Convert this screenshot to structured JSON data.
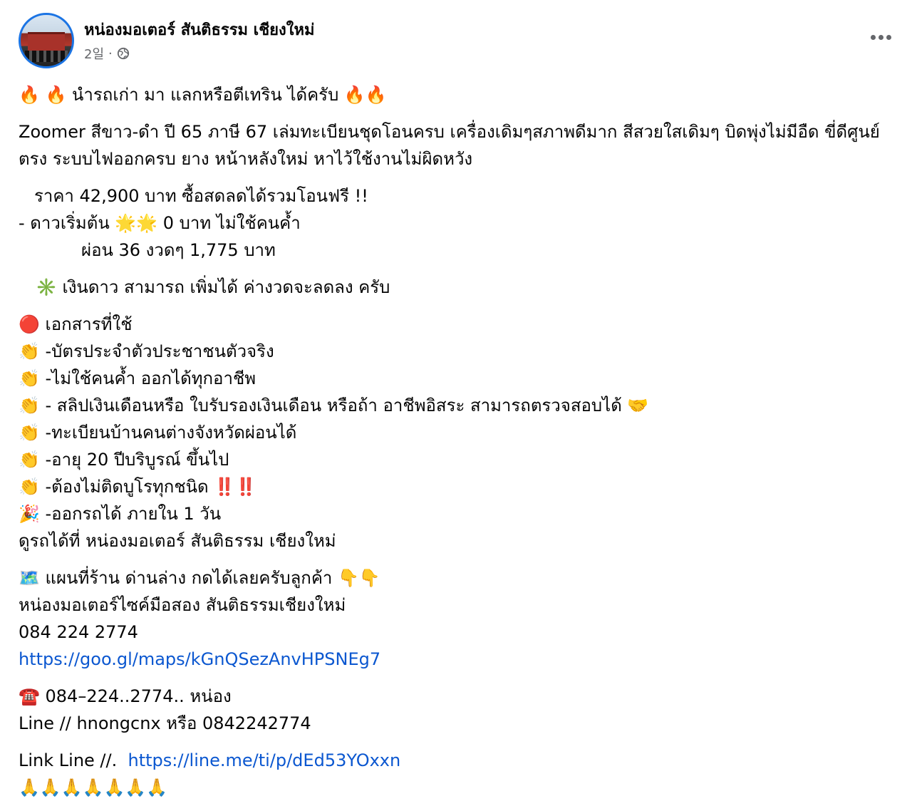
{
  "post": {
    "page_name": "หน่องมอเตอร์ สันติธรรม เชียงใหม่",
    "time": "2일",
    "separator": "·",
    "globe_icon": "globe-icon",
    "more_icon": "more-dots-icon"
  },
  "text": {
    "headline": "🔥 🔥 นำรถเก่า มา แลกหรือตีเทริน ได้ครับ 🔥🔥",
    "desc": "Zoomer สีขาว-ดำ ปี 65 ภาษี 67 เล่มทะเบียนชุดโอนครบ เครื่องเดิมๆสภาพดีมาก สีสวยใสเดิมๆ บิดพุ่งไม่มีอืด ขี่ดีศูนย์ตรง ระบบไฟออกครบ ยาง หน้าหลังใหม่ หาไว้ใช้งานไม่ผิดหวัง",
    "price": "ราคา  42,900 บาท ซื้อสดลดได้รวมโอนฟรี !!",
    "down": "- ดาวเริ่มต้น 🌟🌟 0  บาท ไม่ใช้คนค้ำ",
    "installment": "ผ่อน 36 งวดๆ 1,775 บาท",
    "down_note": "✳️ เงินดาว สามารถ เพิ่มได้ ค่างวดจะลดลง ครับ",
    "docs_title": "🔴 เอกสารที่ใช้",
    "docs": [
      "👏 -บัตรประจำตัวประชาชนตัวจริง",
      "👏 -ไม่ใช้คนค้ำ ออกได้ทุกอาชีพ",
      "👏 - สลิปเงินเดือนหรือ ใบรับรองเงินเดือน หรือถ้า อาชีพอิสระ สามารถตรวจสอบได้ 🤝",
      "👏 -ทะเบียนบ้านคนต่างจังหวัดผ่อนได้",
      "👏 -อายุ 20 ปีบริบูรณ์ ขึ้นไป",
      "👏 -ต้องไม่ติดบูโรทุกชนิด ‼️‼️",
      "🎉 -ออกรถได้ ภายใน 1 วัน"
    ],
    "visit": "ดูรถได้ที่ หน่องมอเตอร์ สันติธรรม เชียงใหม่",
    "map_line": "🗺️ แผนที่ร้าน ด่านล่าง กดได้เลยครับลูกค้า 👇👇",
    "shop_name": "หน่องมอเตอร์ไซค์มือสอง สันติธรรมเชียงใหม่",
    "shop_phone": "084 224 2774",
    "map_url": "https://goo.gl/maps/kGnQSezAnvHPSNEg7",
    "phone_line": "☎️ 084–224..2774..  หน่อง",
    "line_id": "Line // hnongcnx หรือ 0842242774",
    "link_line_label": "Link Line //.",
    "line_url": "https://line.me/ti/p/dEd53YOxxn",
    "pray": "🙏🙏🙏🙏🙏🙏🙏"
  },
  "colors": {
    "link": "#0b57d0",
    "meta": "#65676b",
    "avatar_border": "#1b74e4"
  }
}
